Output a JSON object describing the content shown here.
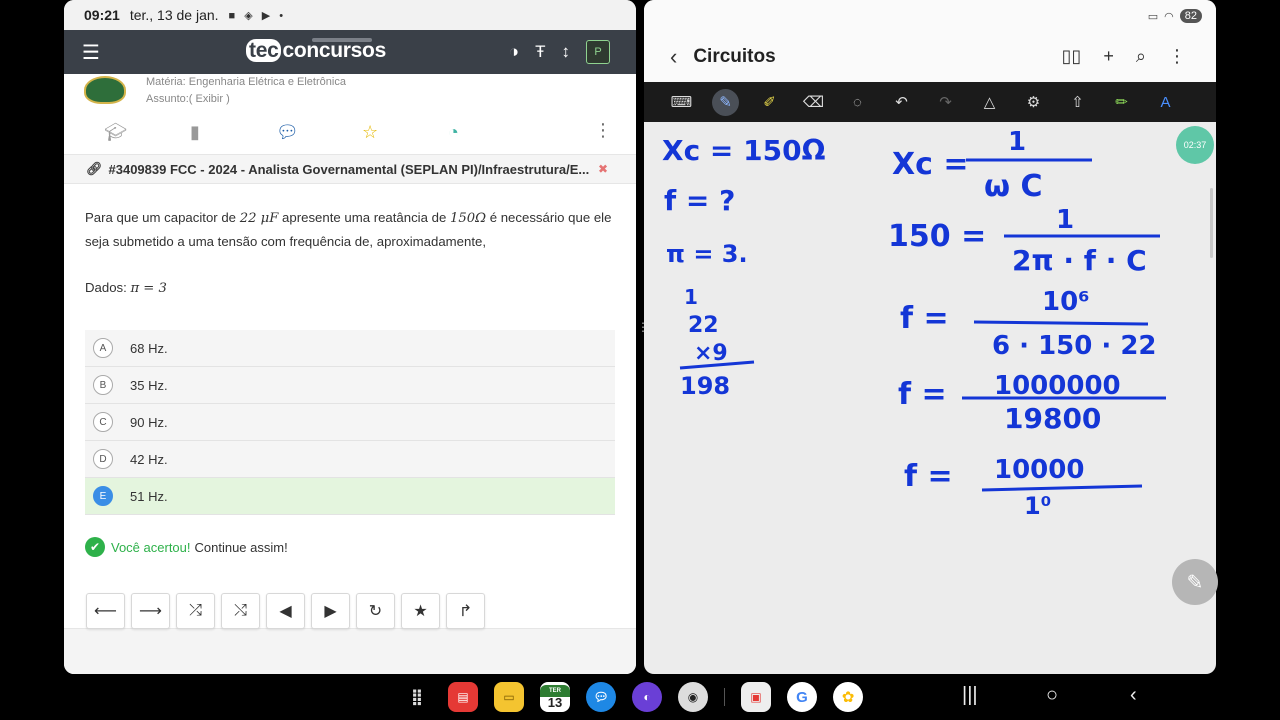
{
  "left_status": {
    "time": "09:21",
    "date": "ter., 13 de jan."
  },
  "tec": {
    "logo_tec": "tec",
    "logo_rest": "concursos",
    "p_badge": "P"
  },
  "meta": {
    "materia": "Matéria: Engenharia Elétrica e Eletrônica",
    "assunto": "Assunto:( Exibir )"
  },
  "question": {
    "header": "#3409839 FCC - 2024 - Analista Governamental (SEPLAN PI)/Infraestrutura/E...",
    "text_a": "Para que um capacitor de ",
    "cap_value": "22 μF",
    "text_b": " apresente uma reatância de ",
    "reactance": "150Ω",
    "text_c": " é necessário que ele seja submetido a uma tensão com frequência de, aproximadamente,",
    "dados_label": "Dados: ",
    "dados_value": "π = 3"
  },
  "options": [
    {
      "letter": "A",
      "text": "68 Hz."
    },
    {
      "letter": "B",
      "text": "35 Hz."
    },
    {
      "letter": "C",
      "text": "90 Hz."
    },
    {
      "letter": "D",
      "text": "42 Hz."
    },
    {
      "letter": "E",
      "text": "51 Hz."
    }
  ],
  "result": {
    "ok": "Você acertou!",
    "continue": "Continue assim!"
  },
  "notes": {
    "title": "Circuitos",
    "timer": "02:37",
    "battery": "82",
    "handwriting": {
      "xc1": "Xc = 150Ω",
      "f1": "f = ?",
      "pi": "π = 3.",
      "mul_carry": "1",
      "mul_top": "22",
      "mul_op": "×9",
      "mul_res": "198",
      "eq1_lhs": "Xc =",
      "eq1_num": "1",
      "eq1_den": "ω C",
      "eq2_lhs": "150 =",
      "eq2_num": "1",
      "eq2_den": "2π · f · C",
      "eq3_lhs": "f =",
      "eq3_num": "10⁶",
      "eq3_den": "6 · 150 · 22",
      "eq4_lhs": "f =",
      "eq4_num": "1000000",
      "eq4_den": "19800",
      "eq5_lhs": "f =",
      "eq5_num": "10000",
      "eq5_den": "1⁰"
    }
  },
  "taskbar": {
    "calendar_label": "TER",
    "calendar_day": "13"
  }
}
